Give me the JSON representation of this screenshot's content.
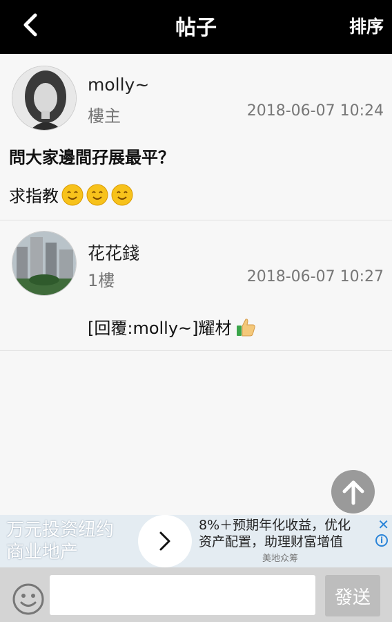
{
  "header": {
    "title": "帖子",
    "sort_label": "排序",
    "back_icon": "chevron-left-icon"
  },
  "posts": [
    {
      "username": "molly~",
      "rank": "樓主",
      "timestamp": "2018-06-07 10:24",
      "title": "問大家邊間孖展最平？",
      "body": "求指教",
      "emojis": [
        "smile-emoji",
        "smile-emoji",
        "smile-emoji"
      ]
    },
    {
      "username": "花花錢",
      "rank": "1樓",
      "timestamp": "2018-06-07 10:27",
      "body": "[回覆:molly~]耀材",
      "emojis": [
        "thumbs-up-emoji"
      ]
    }
  ],
  "ad": {
    "left_text_line1": "万元投资纽约",
    "left_text_line2": "商业地产",
    "right_text_line1": "8%＋预期年化收益，优化",
    "right_text_line2": "资产配置，助理财富增值",
    "source": "美地众筹",
    "close_icon": "close-icon",
    "info_icon": "info-icon"
  },
  "composer": {
    "input_value": "",
    "send_label": "發送",
    "emoji_icon": "smiley-icon"
  },
  "colors": {
    "header_bg": "#000000",
    "page_bg": "#f7f7f7",
    "ad_link": "#2a84d8",
    "send_bg": "#bdbdbd"
  }
}
